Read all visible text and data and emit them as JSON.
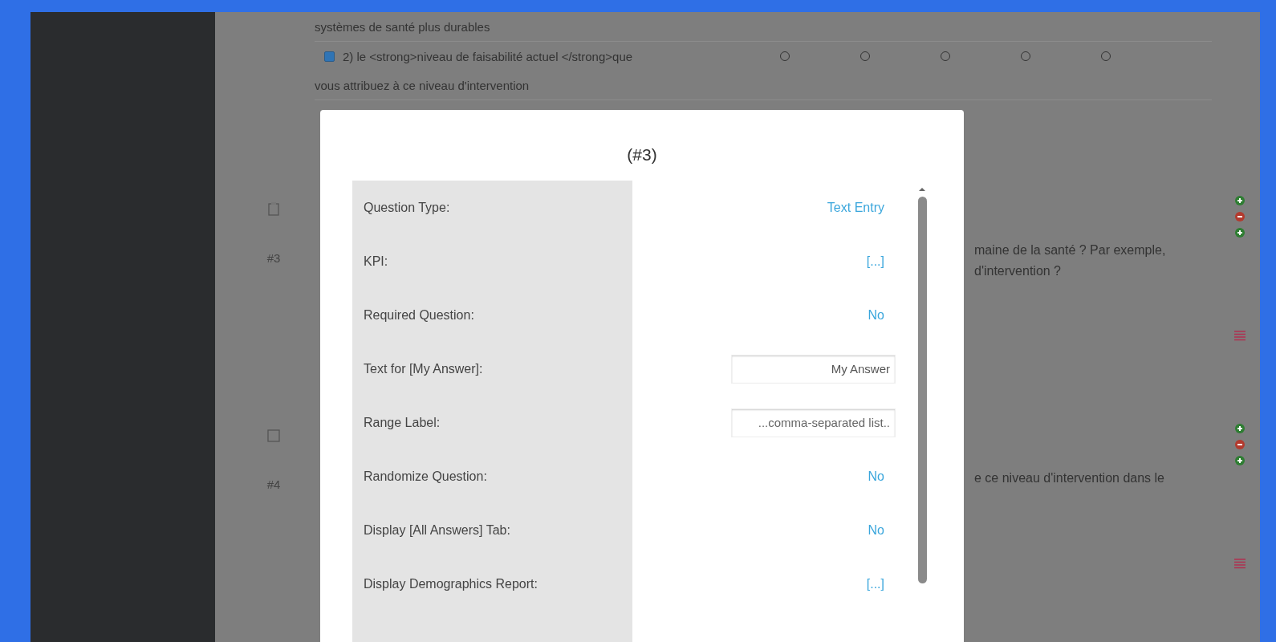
{
  "background": {
    "rows": [
      {
        "kind": "text",
        "text": "systèmes de santé plus durables"
      },
      {
        "kind": "scale",
        "checked": true,
        "text": "2) le <strong>niveau de faisabilité actuel </strong>que",
        "options": [
          {
            "selected": false
          },
          {
            "selected": false
          },
          {
            "selected": false
          },
          {
            "selected": false
          },
          {
            "selected": false
          }
        ]
      },
      {
        "kind": "text",
        "text": "vous attribuez à ce niveau d'intervention"
      }
    ],
    "questions": [
      {
        "number": "#3",
        "kind": "document",
        "lines": [
          "maine de la santé ? Par exemple,",
          "d'intervention ?"
        ]
      },
      {
        "number": "#4",
        "kind": "checkbox",
        "lines": [
          "e ce niveau d'intervention dans le"
        ]
      }
    ]
  },
  "modal": {
    "title": "(#3)",
    "fields": [
      {
        "label": "Question Type:",
        "kind": "link",
        "value": "Text Entry"
      },
      {
        "label": "KPI:",
        "kind": "link",
        "value": "[...]"
      },
      {
        "label": "Required Question:",
        "kind": "link",
        "value": "No"
      },
      {
        "label": "Text for [My Answer]:",
        "kind": "input",
        "value": "My Answer"
      },
      {
        "label": "Range Label:",
        "kind": "input",
        "placeholder": "...comma-separated list.."
      },
      {
        "label": "Randomize Question:",
        "kind": "link",
        "value": "No"
      },
      {
        "label": "Display [All Answers] Tab:",
        "kind": "link",
        "value": "No"
      },
      {
        "label": "Display Demographics Report:",
        "kind": "link",
        "value": "[...]"
      }
    ]
  }
}
